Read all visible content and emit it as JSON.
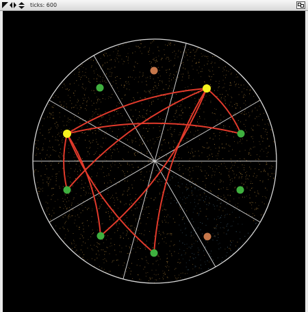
{
  "window": {
    "ticks_label": "ticks: 600",
    "zoom_label": "zoom"
  },
  "colors": {
    "background": "#000000",
    "circle": "#d8d8d8",
    "sector_lines": "#cfcfcf",
    "link": "#e23a2b",
    "node_yellow": "#f5f21e",
    "node_green": "#3fb03f",
    "node_orange": "#c7774a",
    "particles_warm": "#b5863b",
    "particles_cool": "#4a6f86"
  },
  "nodes": [
    {
      "id": "n-yellow-top-right",
      "color": "yellow"
    },
    {
      "id": "n-yellow-left",
      "color": "yellow"
    },
    {
      "id": "n-green-upper-left",
      "color": "green"
    },
    {
      "id": "n-orange-top",
      "color": "orange"
    },
    {
      "id": "n-green-right",
      "color": "green"
    },
    {
      "id": "n-green-right-lower",
      "color": "green"
    },
    {
      "id": "n-green-left-lower",
      "color": "green"
    },
    {
      "id": "n-green-bottom-left",
      "color": "green"
    },
    {
      "id": "n-green-bottom",
      "color": "green"
    },
    {
      "id": "n-orange-bottom-right",
      "color": "orange"
    }
  ],
  "links": [
    {
      "from": "n-yellow-top-right",
      "to": "n-yellow-left"
    },
    {
      "from": "n-yellow-top-right",
      "to": "n-green-right"
    },
    {
      "from": "n-yellow-top-right",
      "to": "n-green-left-lower"
    },
    {
      "from": "n-yellow-top-right",
      "to": "n-green-bottom-left"
    },
    {
      "from": "n-yellow-top-right",
      "to": "n-green-bottom"
    },
    {
      "from": "n-yellow-left",
      "to": "n-green-right"
    },
    {
      "from": "n-yellow-left",
      "to": "n-green-left-lower"
    },
    {
      "from": "n-yellow-left",
      "to": "n-green-bottom-left"
    },
    {
      "from": "n-yellow-left",
      "to": "n-green-bottom"
    }
  ]
}
